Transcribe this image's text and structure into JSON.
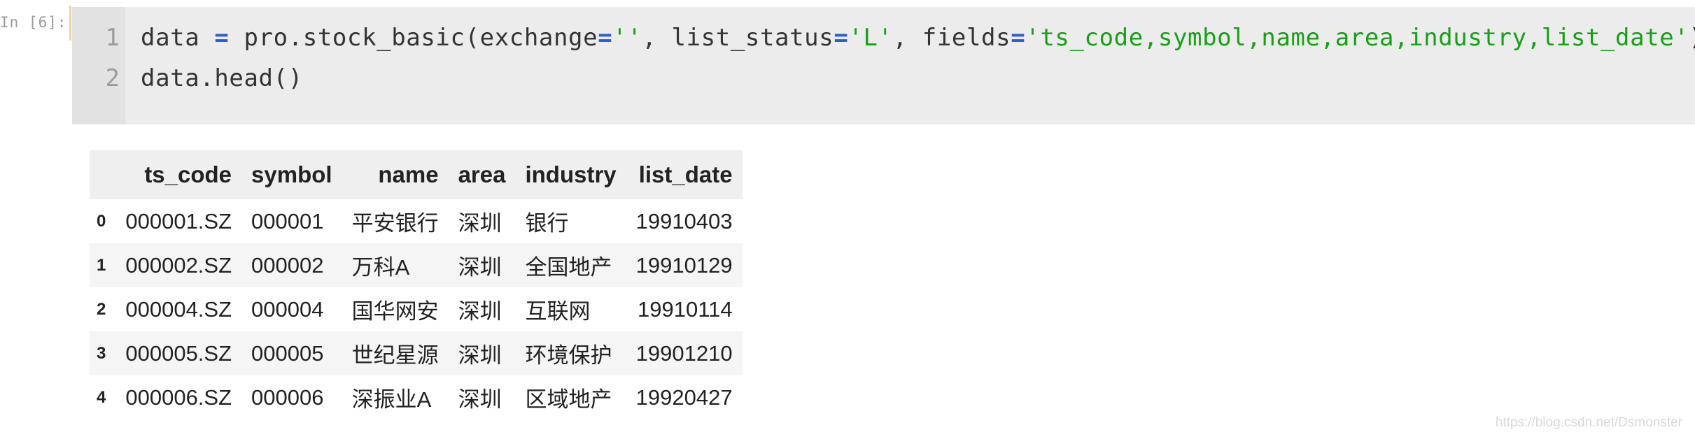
{
  "cell": {
    "prompt": "In [6]:",
    "lines": [
      {
        "number": "1",
        "tokens": [
          {
            "text": "data ",
            "kind": "plain"
          },
          {
            "text": "=",
            "kind": "op"
          },
          {
            "text": " pro.stock_basic(exchange",
            "kind": "plain"
          },
          {
            "text": "=",
            "kind": "op"
          },
          {
            "text": "''",
            "kind": "str"
          },
          {
            "text": ", list_status",
            "kind": "plain"
          },
          {
            "text": "=",
            "kind": "op"
          },
          {
            "text": "'L'",
            "kind": "str"
          },
          {
            "text": ", fields",
            "kind": "plain"
          },
          {
            "text": "=",
            "kind": "op"
          },
          {
            "text": "'ts_code,symbol,name,area,industry,list_date'",
            "kind": "str"
          },
          {
            "text": ")",
            "kind": "plain"
          }
        ]
      },
      {
        "number": "2",
        "tokens": [
          {
            "text": "data.head()",
            "kind": "plain"
          }
        ]
      }
    ],
    "colors": {
      "operator": "#2a5fd0",
      "string": "#16a016",
      "code_bg": "#ececec",
      "gutter_bg": "#e2e2e2"
    }
  },
  "output": {
    "columns": [
      "ts_code",
      "symbol",
      "name",
      "area",
      "industry",
      "list_date"
    ],
    "rows": [
      {
        "index": "0",
        "ts_code": "000001.SZ",
        "symbol": "000001",
        "name": "平安银行",
        "area": "深圳",
        "industry": "银行",
        "list_date": "19910403"
      },
      {
        "index": "1",
        "ts_code": "000002.SZ",
        "symbol": "000002",
        "name": "万科A",
        "area": "深圳",
        "industry": "全国地产",
        "list_date": "19910129"
      },
      {
        "index": "2",
        "ts_code": "000004.SZ",
        "symbol": "000004",
        "name": "国华网安",
        "area": "深圳",
        "industry": "互联网",
        "list_date": "19910114"
      },
      {
        "index": "3",
        "ts_code": "000005.SZ",
        "symbol": "000005",
        "name": "世纪星源",
        "area": "深圳",
        "industry": "环境保护",
        "list_date": "19901210"
      },
      {
        "index": "4",
        "ts_code": "000006.SZ",
        "symbol": "000006",
        "name": "深振业A",
        "area": "深圳",
        "industry": "区域地产",
        "list_date": "19920427"
      }
    ]
  },
  "watermark": "https://blog.csdn.net/Dsmonster"
}
